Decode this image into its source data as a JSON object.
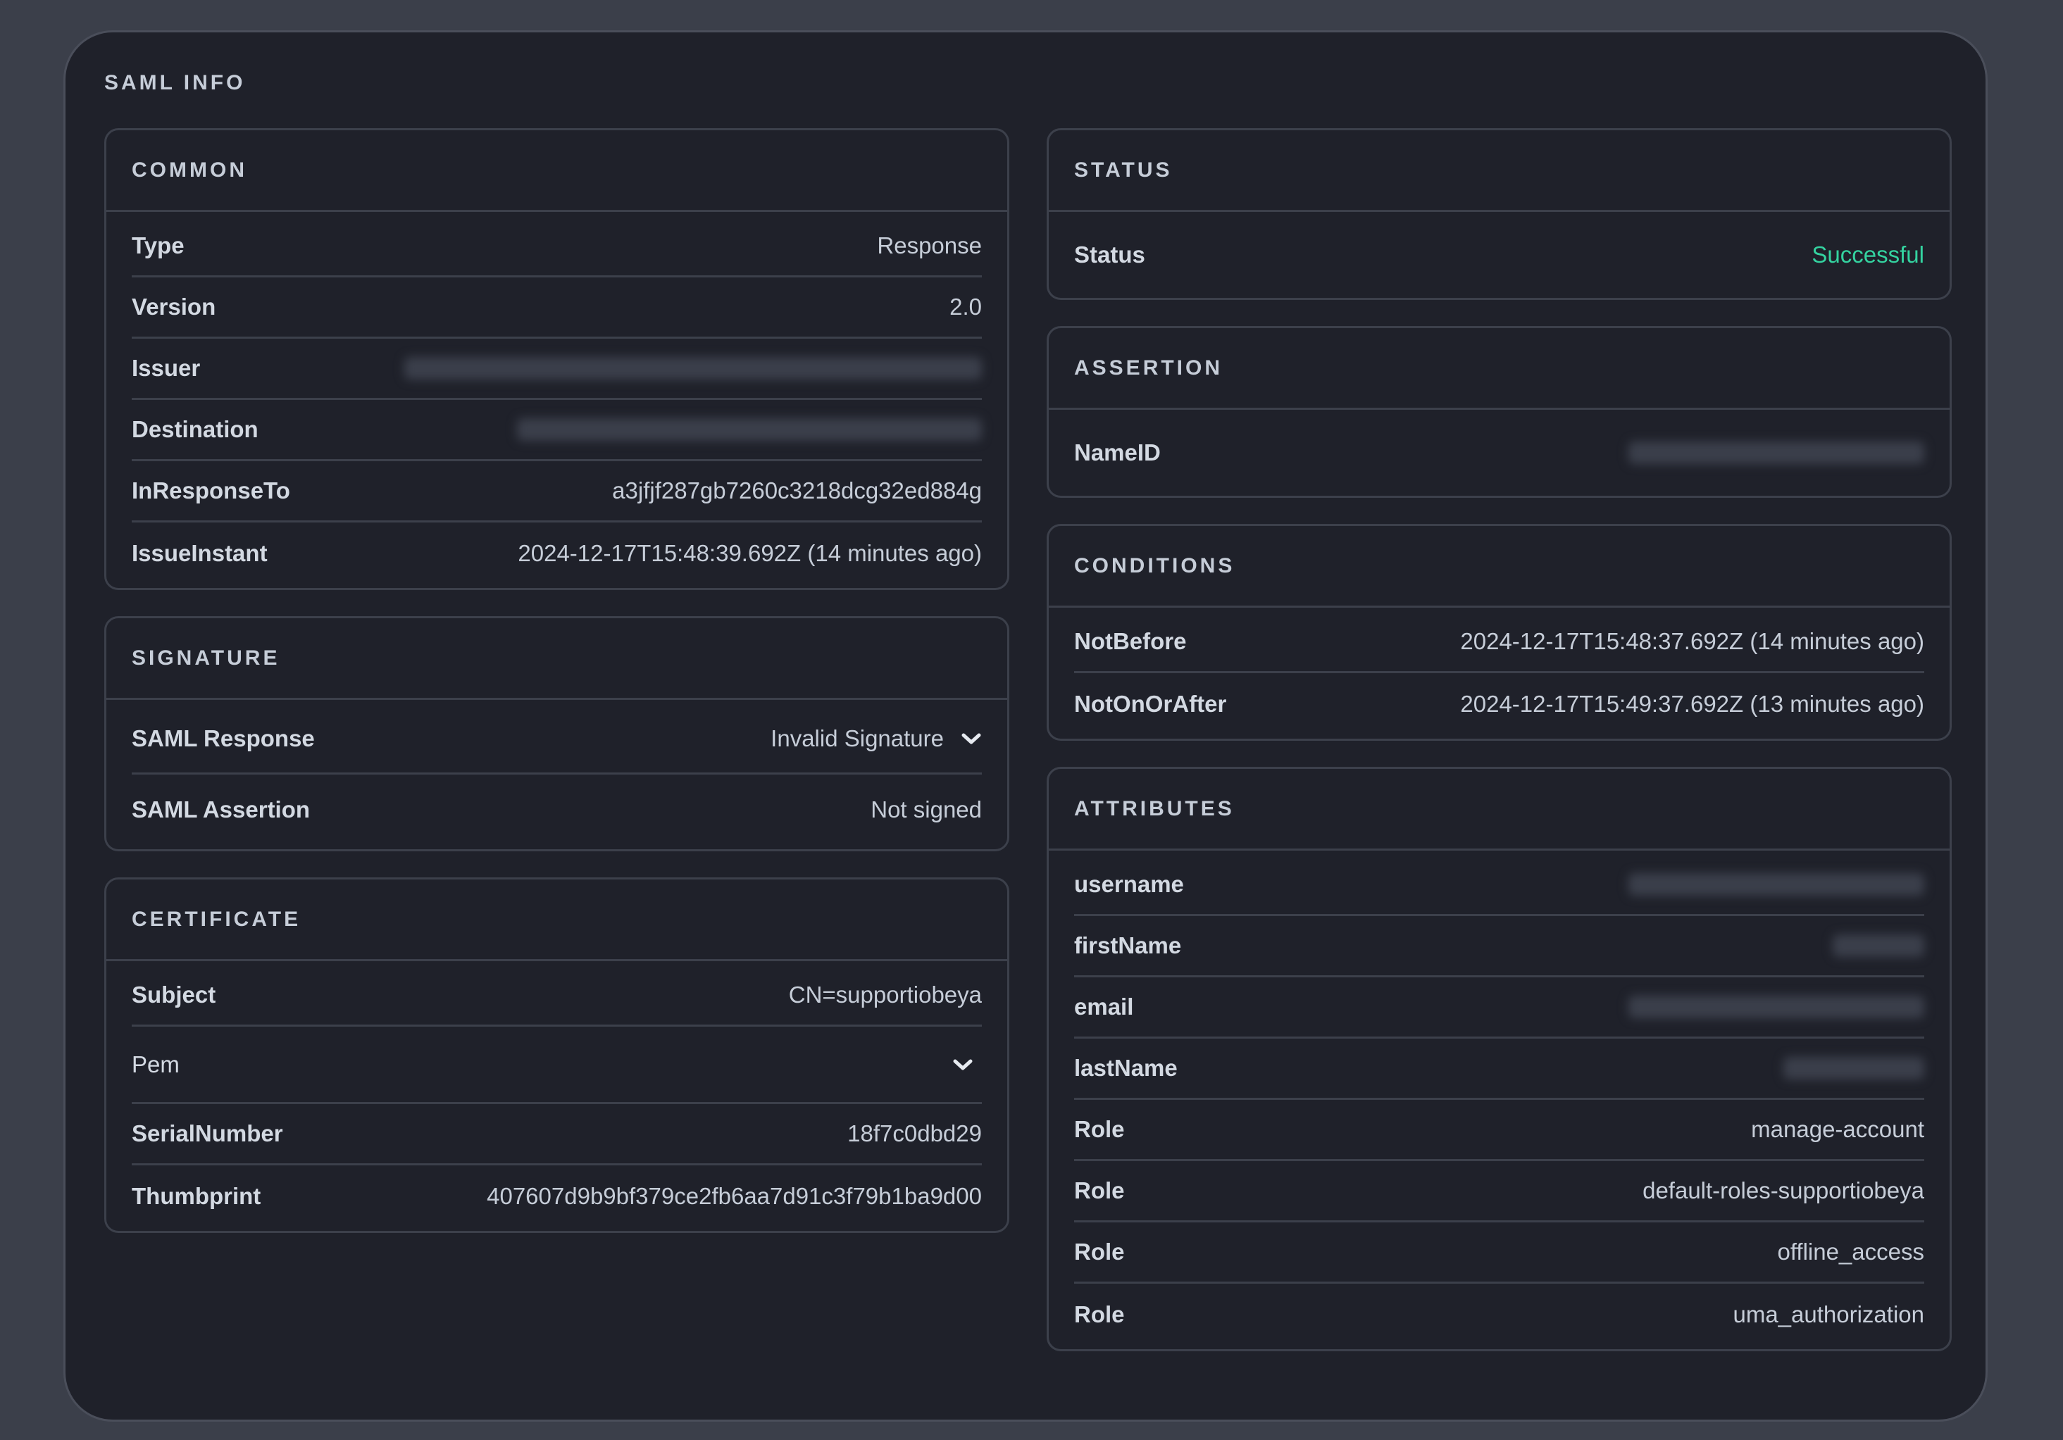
{
  "panel": {
    "title": "SAML INFO"
  },
  "common": {
    "title": "COMMON",
    "rows": [
      {
        "label": "Type",
        "value": "Response"
      },
      {
        "label": "Version",
        "value": "2.0"
      },
      {
        "label": "Issuer",
        "value": null
      },
      {
        "label": "Destination",
        "value": null
      },
      {
        "label": "InResponseTo",
        "value": "a3jfjf287gb7260c3218dcg32ed884g"
      },
      {
        "label": "IssueInstant",
        "value": "2024-12-17T15:48:39.692Z (14 minutes ago)"
      }
    ]
  },
  "signature": {
    "title": "SIGNATURE",
    "rows": [
      {
        "label": "SAML Response",
        "value": "Invalid Signature",
        "icon": "chevron-down-icon"
      },
      {
        "label": "SAML Assertion",
        "value": "Not signed"
      }
    ]
  },
  "certificate": {
    "title": "CERTIFICATE",
    "rows": [
      {
        "label": "Subject",
        "value": "CN=supportiobeya"
      },
      {
        "label": "Pem",
        "icon": "chevron-down-icon"
      },
      {
        "label": "SerialNumber",
        "value": "18f7c0dbd29"
      },
      {
        "label": "Thumbprint",
        "value": "407607d9b9bf379ce2fb6aa7d91c3f79b1ba9d00"
      }
    ]
  },
  "status": {
    "title": "STATUS",
    "rows": [
      {
        "label": "Status",
        "value": "Successful",
        "color": "#34d3a0"
      }
    ]
  },
  "assertion": {
    "title": "ASSERTION",
    "rows": [
      {
        "label": "NameID",
        "value": null
      }
    ]
  },
  "conditions": {
    "title": "CONDITIONS",
    "rows": [
      {
        "label": "NotBefore",
        "value": "2024-12-17T15:48:37.692Z (14 minutes ago)"
      },
      {
        "label": "NotOnOrAfter",
        "value": "2024-12-17T15:49:37.692Z (13 minutes ago)"
      }
    ]
  },
  "attributes": {
    "title": "ATTRIBUTES",
    "rows": [
      {
        "label": "username",
        "value": null
      },
      {
        "label": "firstName",
        "value": null
      },
      {
        "label": "email",
        "value": null
      },
      {
        "label": "lastName",
        "value": null
      },
      {
        "label": "Role",
        "value": "manage-account"
      },
      {
        "label": "Role",
        "value": "default-roles-supportiobeya"
      },
      {
        "label": "Role",
        "value": "offline_access"
      },
      {
        "label": "Role",
        "value": "uma_authorization"
      }
    ]
  }
}
